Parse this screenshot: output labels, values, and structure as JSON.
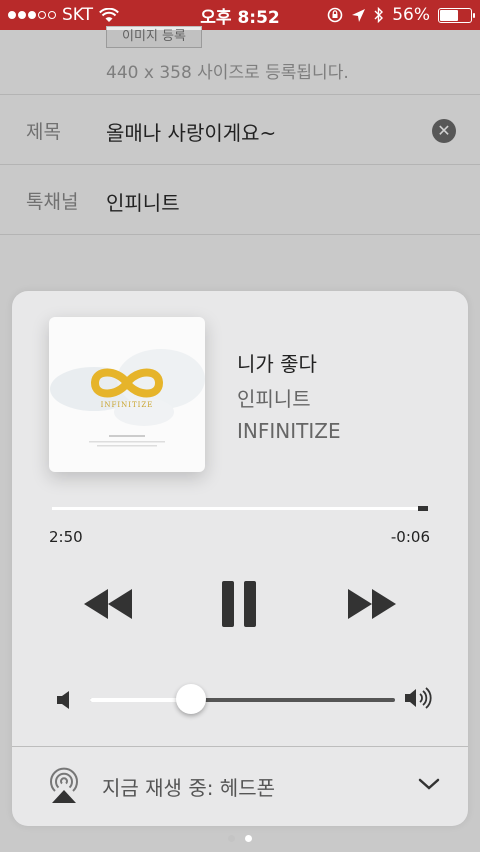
{
  "status_bar": {
    "carrier": "SKT",
    "time": "오후 8:52",
    "battery_percent": "56%",
    "battery_level": 0.56
  },
  "background_form": {
    "image_button_label": "이미지 등록",
    "image_hint": "440 x 358 사이즈로 등록됩니다.",
    "title_label": "제목",
    "title_value": "올매나 사랑이게요~",
    "channel_label": "톡채널",
    "channel_value": "인피니트"
  },
  "now_playing": {
    "title": "니가 좋다",
    "artist": "인피니트",
    "album": "INFINITIZE",
    "album_art_text": "INFINITIZE",
    "elapsed": "2:50",
    "remaining": "-0:06",
    "progress": 0.97,
    "volume": 0.33,
    "output_label": "지금 재생 중: 헤드폰"
  },
  "pager": {
    "pages": 2,
    "active_page": 2
  },
  "colors": {
    "status_bar": "#b82a2a",
    "card_background": "#e8e8e9",
    "accent_gold": "#e6b42a"
  }
}
